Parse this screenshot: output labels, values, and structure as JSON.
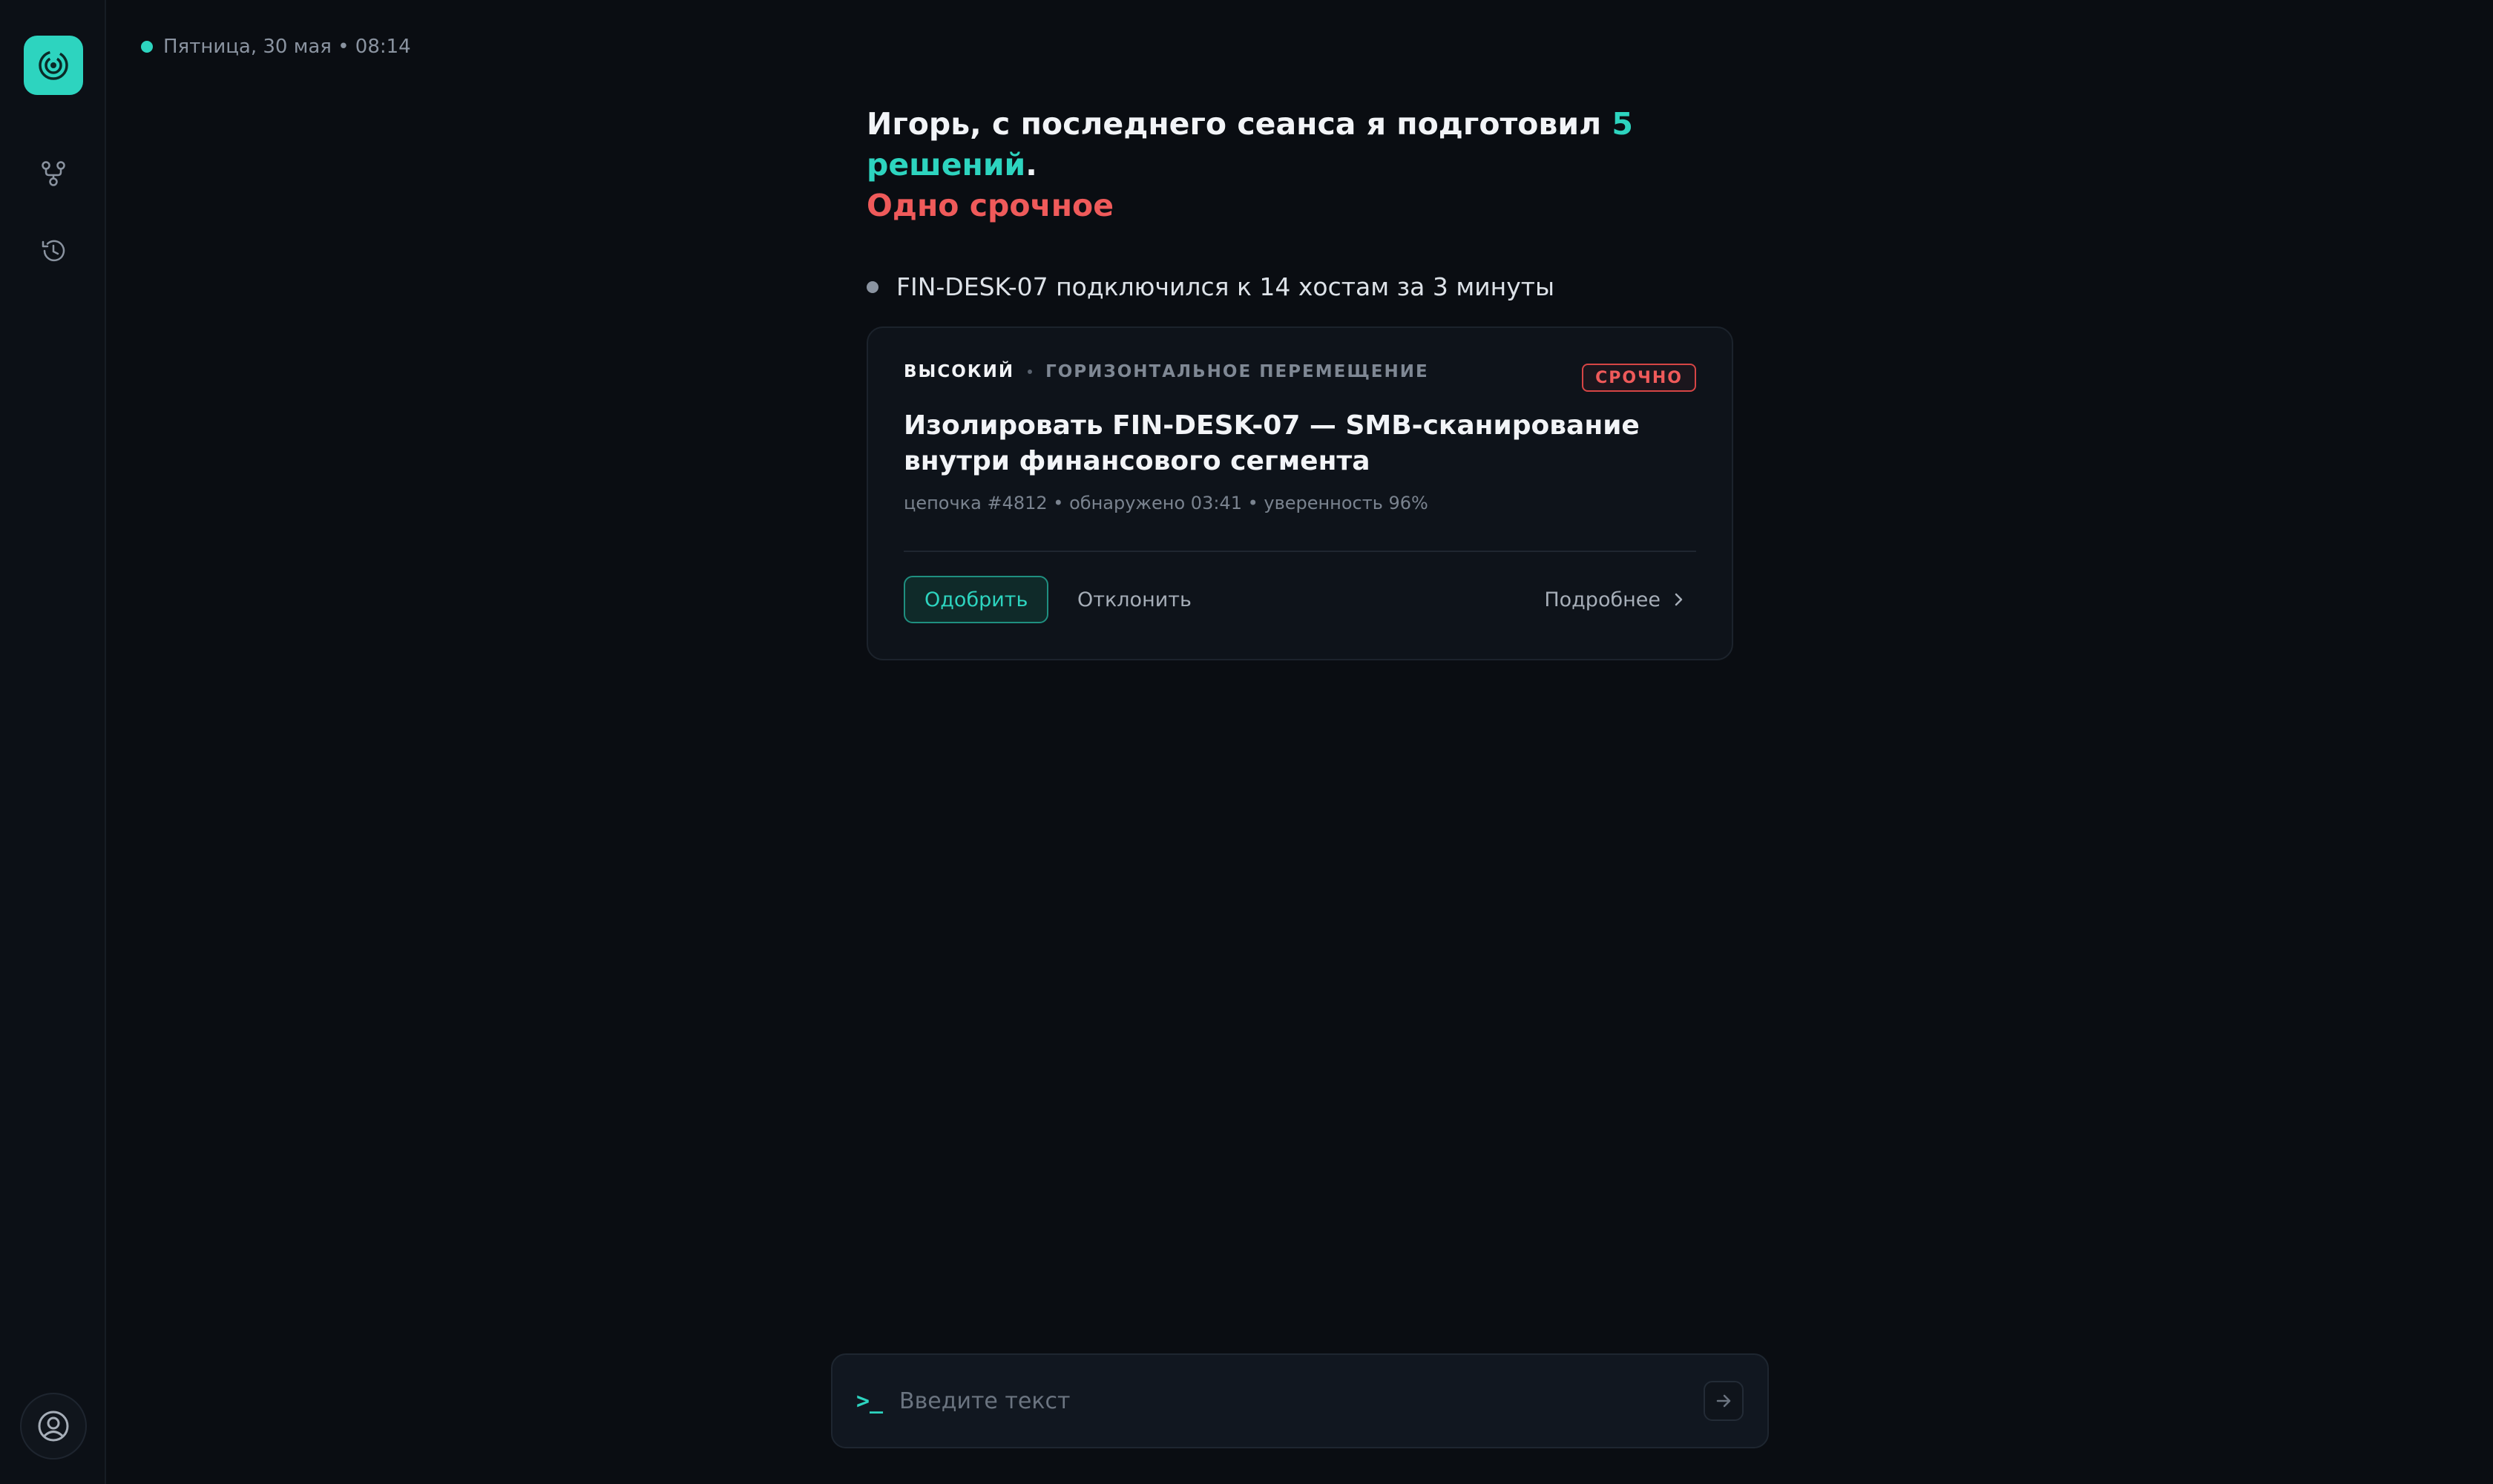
{
  "header": {
    "date_text": "Пятница, 30 мая • 08:14"
  },
  "sidebar": {
    "items": [
      {
        "icon": "graph-icon"
      },
      {
        "icon": "history-icon"
      }
    ]
  },
  "greeting": {
    "prefix": "Игорь, с последнего сеанса я подготовил ",
    "highlight": "5 решений",
    "suffix": ".",
    "urgent": "Одно срочное"
  },
  "event": {
    "text": "FIN-DESK-07 подключился к 14 хостам за 3 минуты"
  },
  "card": {
    "severity": "ВЫСОКИЙ",
    "category": "ГОРИЗОНТАЛЬНОЕ ПЕРЕМЕЩЕНИЕ",
    "badge": "СРОЧНО",
    "title": "Изолировать FIN-DESK-07 — SMB-сканирование внутри финансового сегмента",
    "subtitle": "цепочка #4812 • обнаружено 03:41 • уверенность 96%",
    "approve_label": "Одобрить",
    "reject_label": "Отклонить",
    "details_label": "Подробнее"
  },
  "input": {
    "prompt_glyph": ">_",
    "placeholder": "Введите текст"
  },
  "colors": {
    "accent": "#2dd4bf",
    "urgent": "#ef5a5a",
    "background": "#0a0d12"
  }
}
